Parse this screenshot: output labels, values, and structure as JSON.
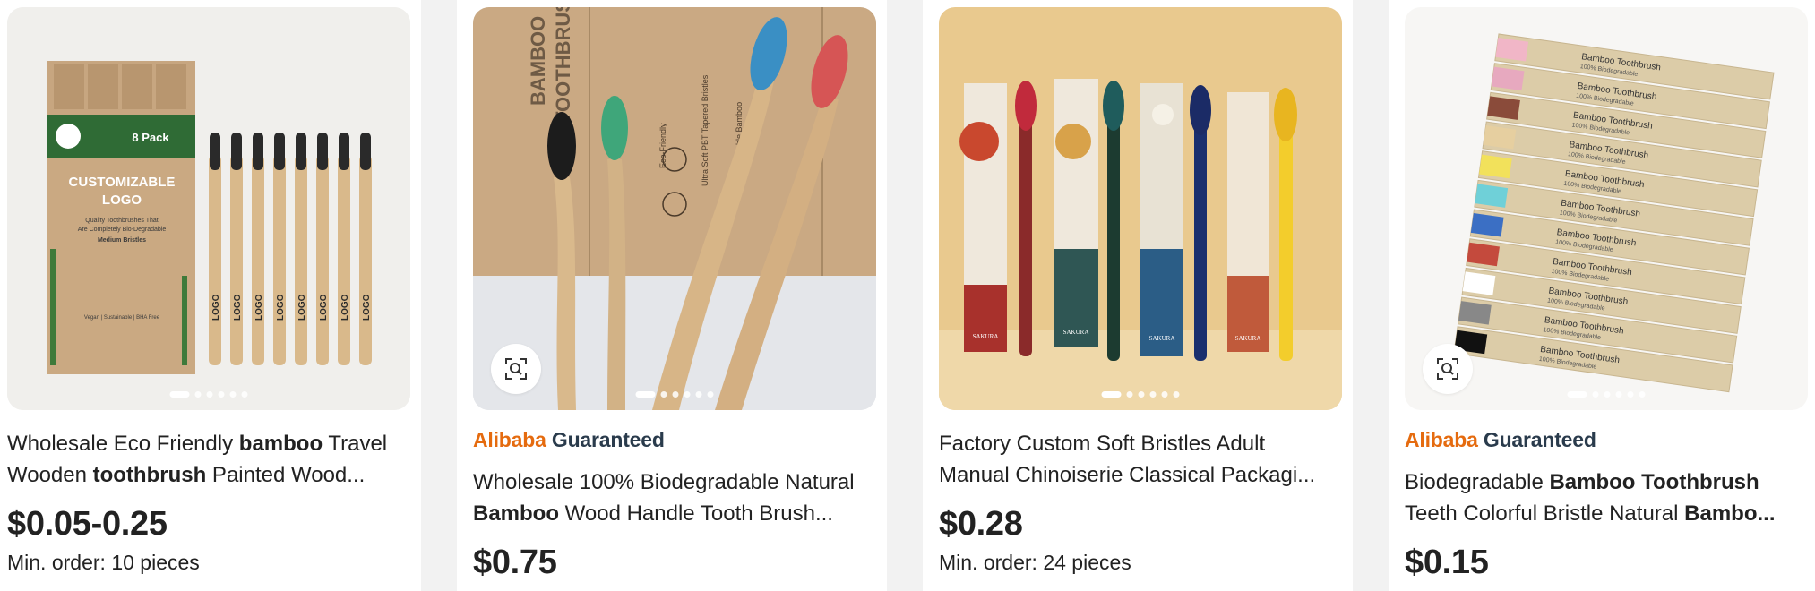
{
  "products": [
    {
      "title_line1_parts": [
        {
          "text": "Wholesale Eco Friendly ",
          "bold": false
        },
        {
          "text": "bamboo",
          "bold": true
        },
        {
          "text": " Travel",
          "bold": false
        }
      ],
      "title_line2_parts": [
        {
          "text": "Wooden ",
          "bold": false
        },
        {
          "text": "toothbrush",
          "bold": true
        },
        {
          "text": " Painted Wood...",
          "bold": false
        }
      ],
      "price": "$0.05-0.25",
      "moq": "Min. order: 10 pieces",
      "image": {
        "pack_badge": "8 Pack",
        "headline_1": "CUSTOMIZABLE",
        "headline_2": "LOGO",
        "subline_1": "Quality Toothbrushes That",
        "subline_2": "Are Completely Bio-Degradable",
        "bristles": "Medium Bristles",
        "footer": "Vegan | Sustainable | BHA Free",
        "handle_text": "LOGO"
      }
    },
    {
      "guaranteed": {
        "brand": "Alibaba",
        "word": "Guaranteed"
      },
      "title_line1_parts": [
        {
          "text": "Wholesale 100% Biodegradable Natural",
          "bold": false
        }
      ],
      "title_line2_parts": [
        {
          "text": "Bamboo",
          "bold": true
        },
        {
          "text": " Wood Handle Tooth Brush...",
          "bold": false
        }
      ],
      "price": "$0.75",
      "image": {
        "box_text_1": "BAMBOO",
        "box_text_2": "TOOTHBRUSH",
        "label_eco": "Eco-Friendly",
        "label_soft": "Ultra Soft PBT Tapered Bristles",
        "label_bio": "Biodegradable Bamboo"
      }
    },
    {
      "title_line1_parts": [
        {
          "text": "Factory Custom Soft Bristles Adult",
          "bold": false
        }
      ],
      "title_line2_parts": [
        {
          "text": "Manual Chinoiserie Classical Packagi...",
          "bold": false
        }
      ],
      "price": "$0.28",
      "moq": "Min. order: 24 pieces",
      "image": {
        "brand": "SAKURA"
      }
    },
    {
      "guaranteed": {
        "brand": "Alibaba",
        "word": "Guaranteed"
      },
      "title_line1_parts": [
        {
          "text": "Biodegradable ",
          "bold": false
        },
        {
          "text": "Bamboo Toothbrush",
          "bold": true
        }
      ],
      "title_line2_parts": [
        {
          "text": "Teeth Colorful Bristle Natural ",
          "bold": false
        },
        {
          "text": "Bambo...",
          "bold": true
        }
      ],
      "price": "$0.15",
      "image": {
        "label_1": "Bamboo Toothbrush",
        "label_2": "100% Biodegradable"
      }
    }
  ],
  "colors": {
    "accent_orange": "#e56b0f",
    "guaranteed_dark": "#2a3b4c",
    "gap_gray": "#f2f2f2"
  },
  "icons": {
    "image_search": "image-search-icon"
  }
}
